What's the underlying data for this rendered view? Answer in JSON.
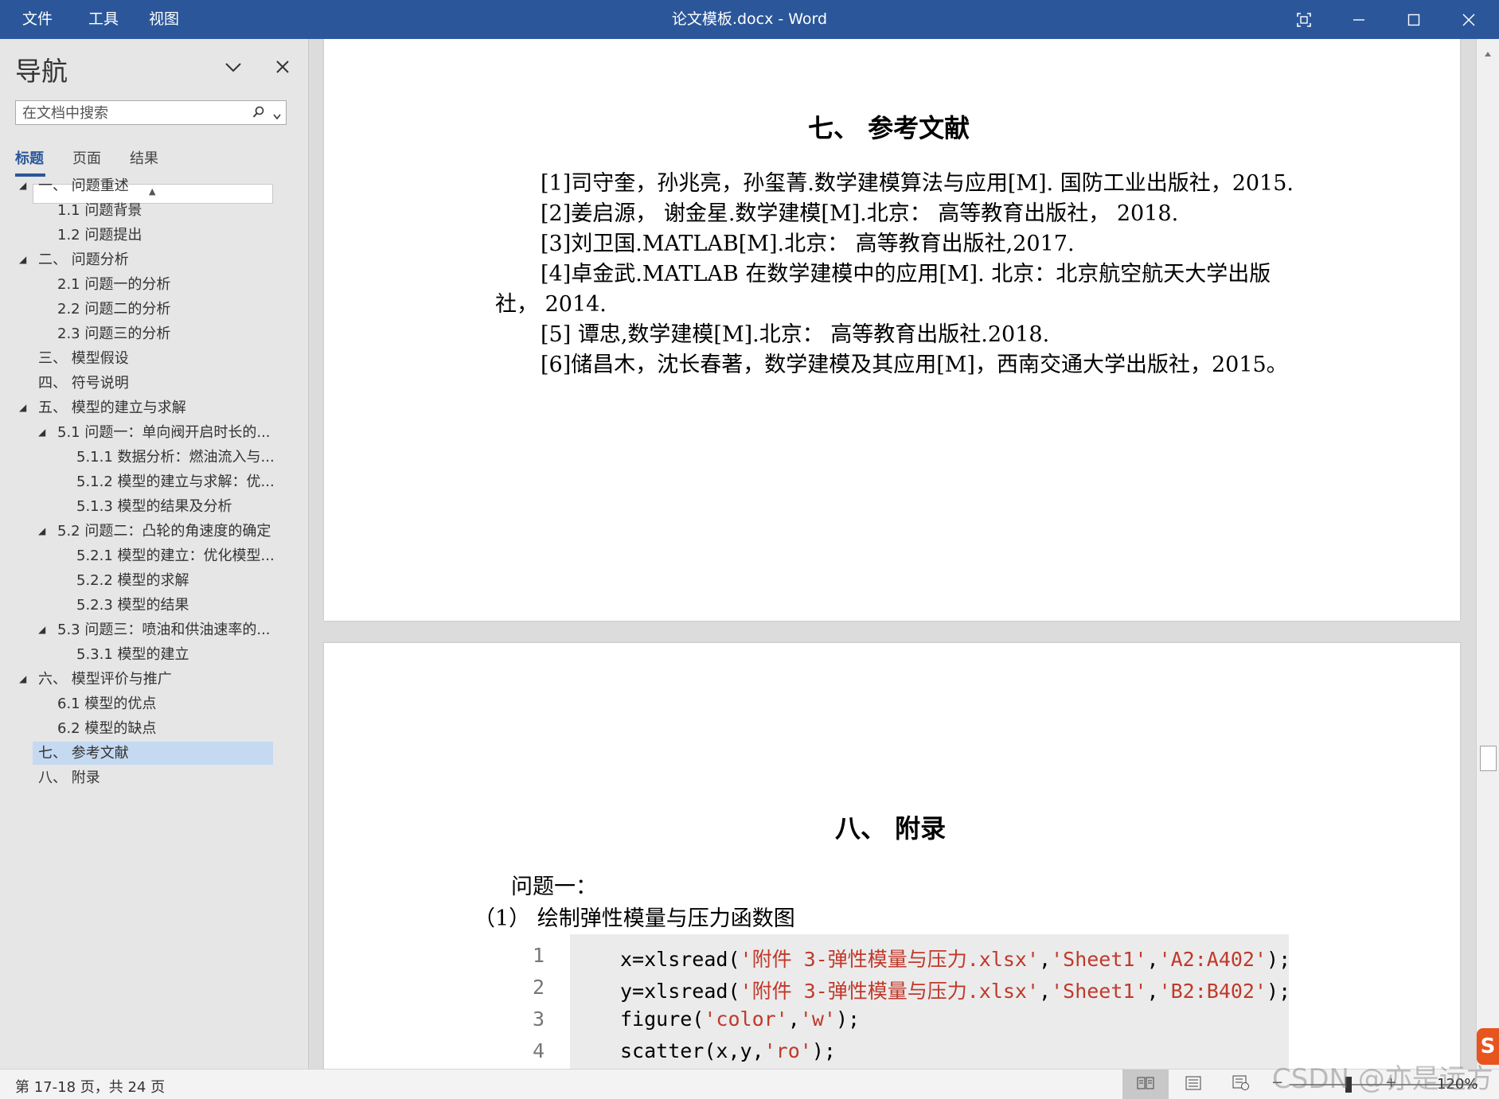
{
  "titlebar": {
    "menus": [
      "文件",
      "工具",
      "视图"
    ],
    "doc_title": "论文模板.docx  -  Word"
  },
  "nav": {
    "title": "导航",
    "search_placeholder": "在文档中搜索",
    "tabs": [
      "标题",
      "页面",
      "结果"
    ],
    "outline": [
      {
        "label": "一、 问题重述",
        "level": 1,
        "expanded": true
      },
      {
        "label": "1.1 问题背景",
        "level": 2
      },
      {
        "label": "1.2 问题提出",
        "level": 2
      },
      {
        "label": "二、 问题分析",
        "level": 1,
        "expanded": true
      },
      {
        "label": "2.1 问题一的分析",
        "level": 2
      },
      {
        "label": "2.2 问题二的分析",
        "level": 2
      },
      {
        "label": "2.3 问题三的分析",
        "level": 2
      },
      {
        "label": "三、 模型假设",
        "level": 1
      },
      {
        "label": "四、 符号说明",
        "level": 1
      },
      {
        "label": "五、 模型的建立与求解",
        "level": 1,
        "expanded": true
      },
      {
        "label": "5.1 问题一：单向阀开启时长的...",
        "level": 2,
        "expanded": true
      },
      {
        "label": "5.1.1 数据分析：燃油流入与...",
        "level": 3
      },
      {
        "label": "5.1.2 模型的建立与求解：优...",
        "level": 3
      },
      {
        "label": "5.1.3 模型的结果及分析",
        "level": 3
      },
      {
        "label": "5.2 问题二：凸轮的角速度的确定",
        "level": 2,
        "expanded": true
      },
      {
        "label": "5.2.1 模型的建立：优化模型...",
        "level": 3
      },
      {
        "label": "5.2.2 模型的求解",
        "level": 3
      },
      {
        "label": "5.2.3 模型的结果",
        "level": 3
      },
      {
        "label": "5.3 问题三：喷油和供油速率的...",
        "level": 2,
        "expanded": true
      },
      {
        "label": "5.3.1 模型的建立",
        "level": 3
      },
      {
        "label": "六、 模型评价与推广",
        "level": 1,
        "expanded": true
      },
      {
        "label": "6.1 模型的优点",
        "level": 2
      },
      {
        "label": "6.2 模型的缺点",
        "level": 2
      },
      {
        "label": "七、 参考文献",
        "level": 1,
        "selected": true
      },
      {
        "label": "八、 附录",
        "level": 1
      }
    ]
  },
  "doc": {
    "section7_title": "七、 参考文献",
    "references": [
      "[1]司守奎，孙兆亮，孙玺菁.数学建模算法与应用[M].  国防工业出版社，2015.",
      "[2]姜启源，  谢金星.数学建模[M].北京：  高等教育出版社，  2018.",
      "[3]刘卫国.MATLAB[M].北京：  高等教育出版社,2017.",
      "[4]卓金武.MATLAB 在数学建模中的应用[M].  北京：北京航空航天大学出版",
      "社，  2014.",
      "[5]  谭忠,数学建模[M].北京：  高等教育出版社.2018.",
      "[6]储昌木，沈长春著，数学建模及其应用[M]，西南交通大学出版社，2015。"
    ],
    "section8_title": "八、 附录",
    "problem_label": "问题一：",
    "subtitle": "（1）  绘制弹性模量与压力函数图",
    "code_lines": [
      {
        "num": "1",
        "pre": "x=xlsread(",
        "s1": "'附件 3-弹性模量与压力.xlsx'",
        "mid": ",",
        "s2": "'Sheet1'",
        "mid2": ",",
        "s3": "'A2:A402'",
        "post": ");"
      },
      {
        "num": "2",
        "pre": "y=xlsread(",
        "s1": "'附件 3-弹性模量与压力.xlsx'",
        "mid": ",",
        "s2": "'Sheet1'",
        "mid2": ",",
        "s3": "'B2:B402'",
        "post": ");"
      },
      {
        "num": "3",
        "pre": "figure(",
        "s1": "'color'",
        "mid": ",",
        "s2": "'w'",
        "mid2": "",
        "s3": "",
        "post": ");"
      },
      {
        "num": "4",
        "pre": "scatter(x,y,",
        "s1": "'ro'",
        "mid": "",
        "s2": "",
        "mid2": "",
        "s3": "",
        "post": ");"
      }
    ]
  },
  "status": {
    "page_info": "第 17-18 页，共 24 页",
    "zoom_minus": "−",
    "zoom_plus": "+",
    "zoom": "120%"
  },
  "watermark": "CSDN @亦是远方",
  "colors": {
    "titlebar": "#2b579a",
    "code_string": "#c0392b",
    "selection": "#c5d9f1"
  }
}
